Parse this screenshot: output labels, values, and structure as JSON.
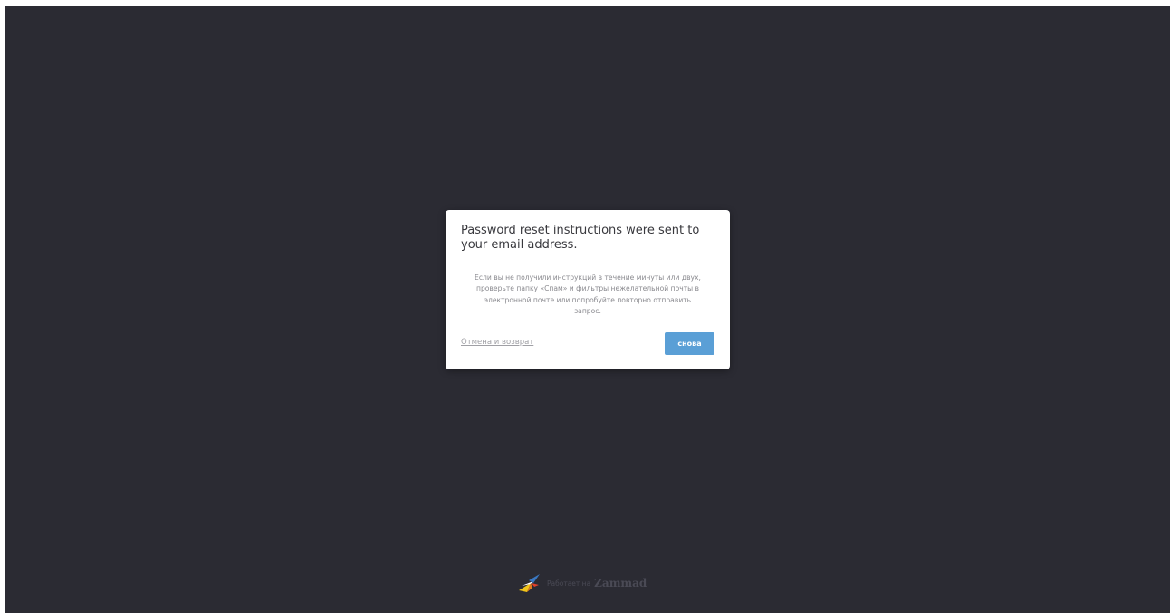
{
  "modal": {
    "title": "Password reset instructions were sent to your email address.",
    "body": "Если вы не получили инструкций в течение минуты или двух, проверьте папку «Спам» и фильтры нежелательной почты в электронной почте или попробуйте повторно отправить запрос.",
    "cancel_label": "Отмена и возврат",
    "retry_label": "снова"
  },
  "footer": {
    "powered_by": "Работает на",
    "brand": "Zammad"
  },
  "colors": {
    "background": "#2b2b33",
    "primary_button": "#5a9fd6",
    "modal_background": "#ffffff"
  }
}
